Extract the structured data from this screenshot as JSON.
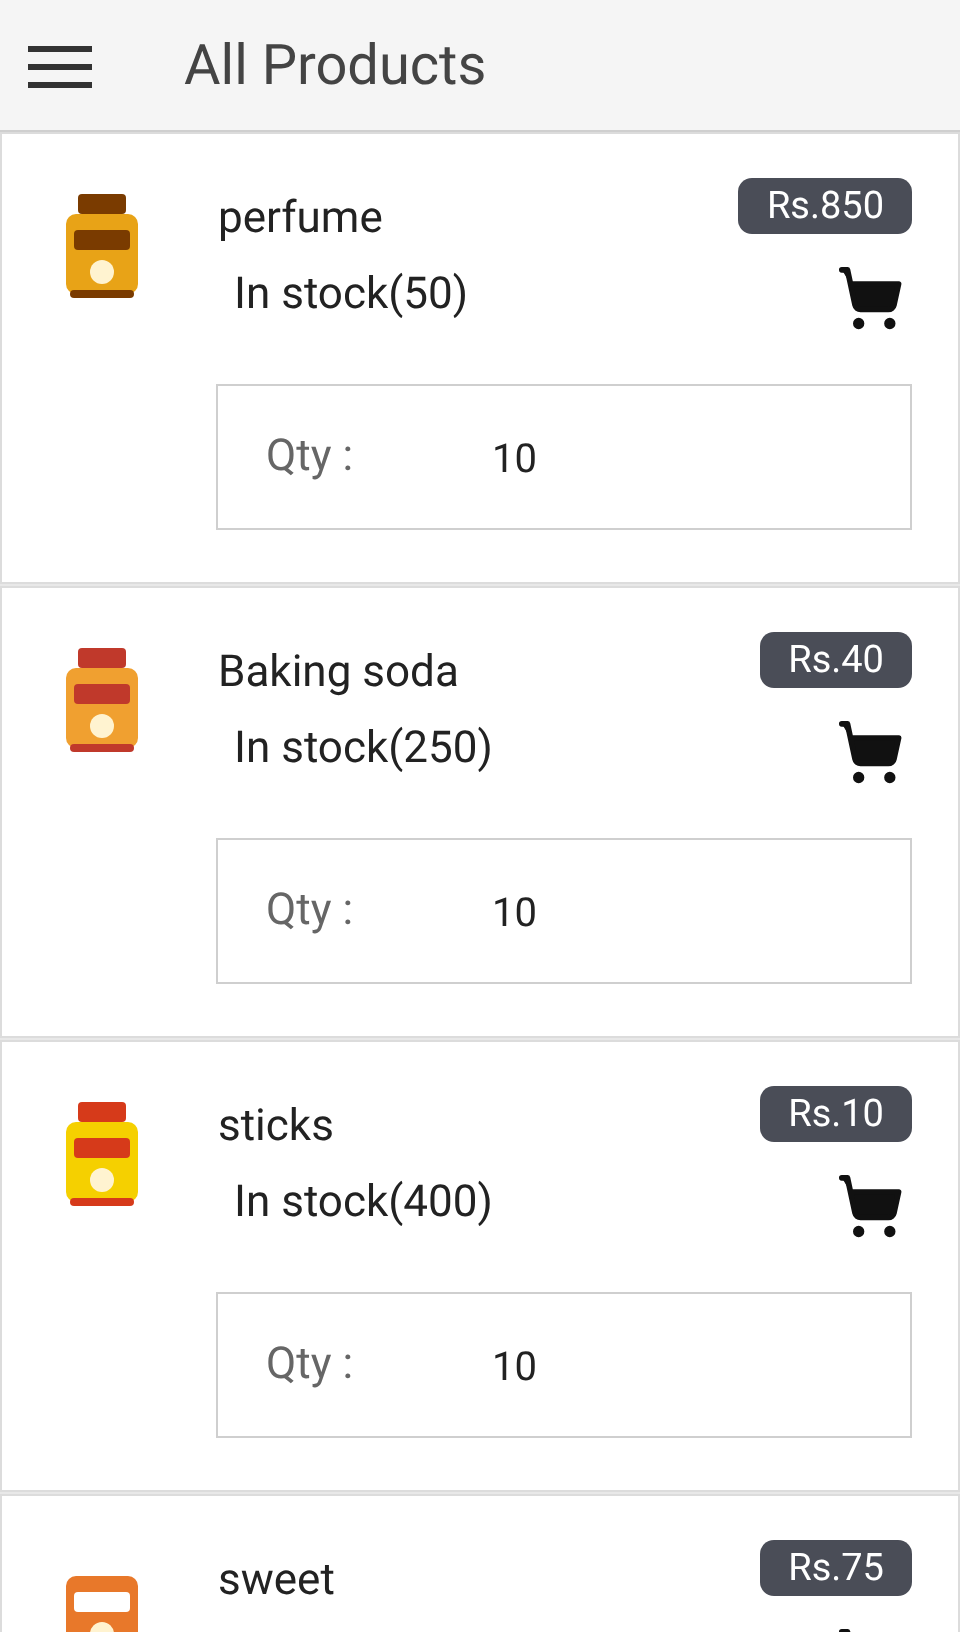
{
  "header": {
    "title": "All Products"
  },
  "products": [
    {
      "name": "perfume",
      "price": "Rs.850",
      "stock": "In stock(50)",
      "qty_label": "Qty :",
      "qty": "10"
    },
    {
      "name": "Baking soda",
      "price": "Rs.40",
      "stock": "In stock(250)",
      "qty_label": "Qty :",
      "qty": "10"
    },
    {
      "name": "sticks",
      "price": "Rs.10",
      "stock": "In stock(400)",
      "qty_label": "Qty :",
      "qty": "10"
    },
    {
      "name": "sweet",
      "price": "Rs.75"
    }
  ]
}
